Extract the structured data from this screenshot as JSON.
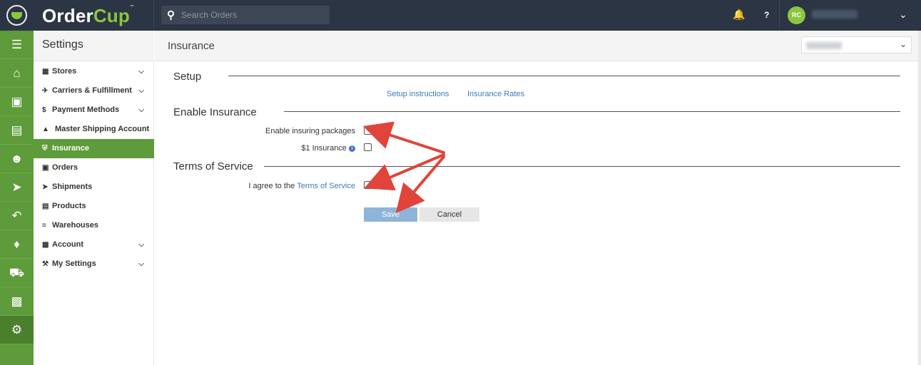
{
  "app": {
    "logo_main": "Order",
    "logo_accent": "Cup",
    "logo_tm": "™"
  },
  "topbar": {
    "search_placeholder": "Search Orders",
    "help_label": "?",
    "avatar_initials": "RC"
  },
  "icons": {
    "menu": "menu-icon",
    "home": "home-icon",
    "orders": "money-icon",
    "products": "archive-icon",
    "customers": "users-icon",
    "shipments": "rocket-icon",
    "returns": "reply-icon",
    "tags": "tag-icon",
    "truck": "truck-icon",
    "reports": "chart-icon",
    "settings": "gears-icon"
  },
  "sidebar": {
    "title": "Settings",
    "items": [
      {
        "label": "Stores",
        "icon": "gift-icon",
        "chevron": true
      },
      {
        "label": "Carriers & Fulfillment",
        "icon": "plane-icon",
        "chevron": true
      },
      {
        "label": "Payment Methods",
        "icon": "dollar-icon",
        "chevron": true
      },
      {
        "label": "Master Shipping Account",
        "icon": "graduation-cap-icon",
        "chevron": false
      },
      {
        "label": "Insurance",
        "icon": "shield-icon",
        "chevron": false,
        "active": true
      },
      {
        "label": "Orders",
        "icon": "money-icon",
        "chevron": false
      },
      {
        "label": "Shipments",
        "icon": "rocket-icon",
        "chevron": false
      },
      {
        "label": "Products",
        "icon": "archive-icon",
        "chevron": false
      },
      {
        "label": "Warehouses",
        "icon": "database-icon",
        "chevron": false
      },
      {
        "label": "Account",
        "icon": "briefcase-icon",
        "chevron": true
      },
      {
        "label": "My Settings",
        "icon": "wrench-icon",
        "chevron": true
      }
    ]
  },
  "content": {
    "title": "Insurance",
    "sections": {
      "setup": "Setup",
      "enable": "Enable Insurance",
      "tos": "Terms of Service"
    },
    "links": {
      "setup_instructions": "Setup instructions",
      "insurance_rates": "Insurance Rates"
    },
    "fields": {
      "enable_packages": "Enable insuring packages",
      "one_dollar": "$1 Insurance",
      "agree_prefix": "I agree to the ",
      "agree_link": "Terms of Service"
    },
    "buttons": {
      "save": "Save",
      "cancel": "Cancel"
    }
  },
  "colors": {
    "topbar": "#2b3543",
    "green": "#5e9b3a",
    "link": "#3b7bb8",
    "arrow": "#e0443a"
  }
}
